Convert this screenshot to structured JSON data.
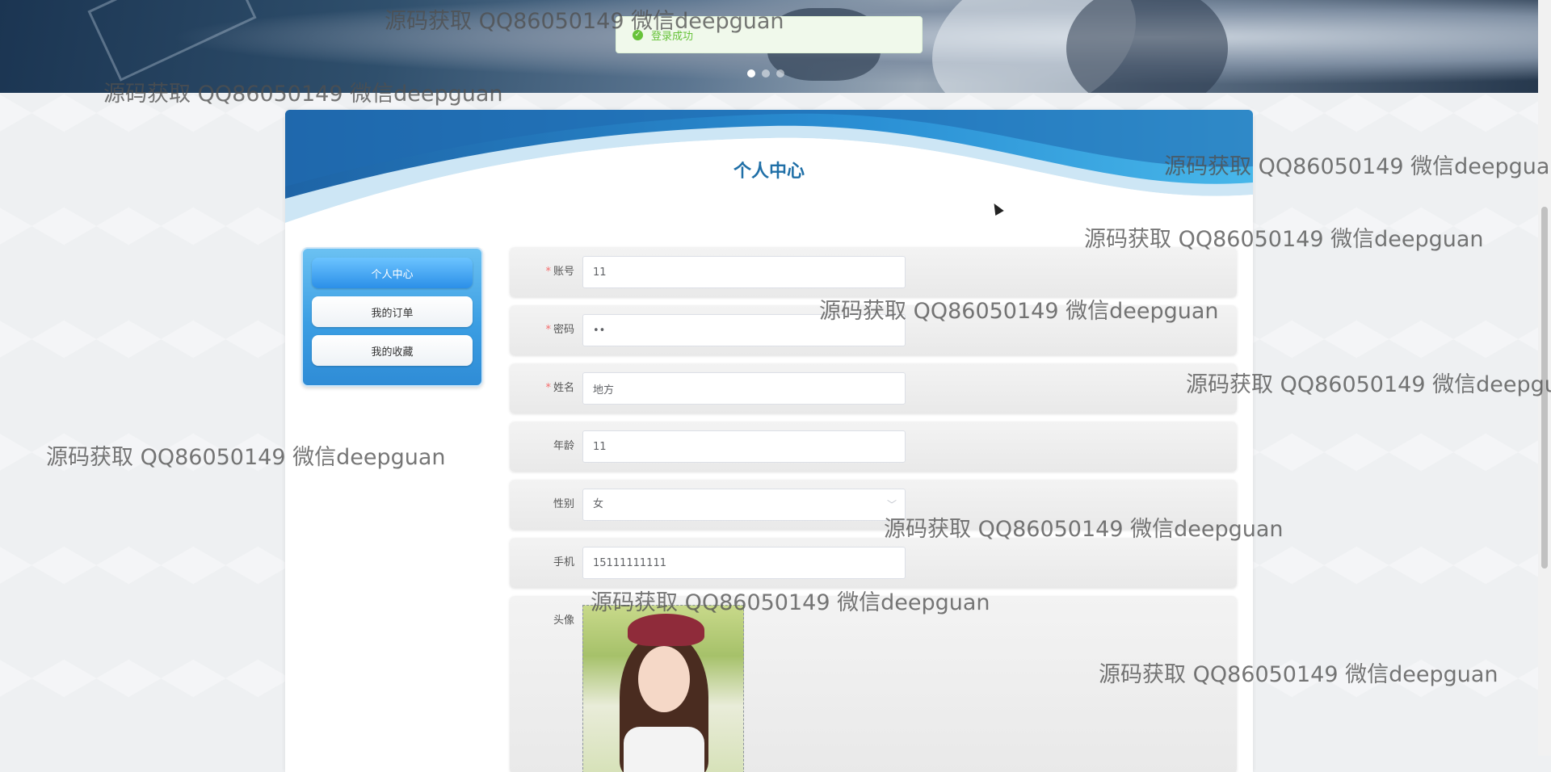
{
  "toast": {
    "message": "登录成功",
    "icon": "check-circle-icon"
  },
  "banner": {
    "carousel_dots": 3,
    "active_dot": 1
  },
  "panel": {
    "title": "个人中心"
  },
  "side_menu": {
    "items": [
      {
        "label": "个人中心",
        "active": true
      },
      {
        "label": "我的订单",
        "active": false
      },
      {
        "label": "我的收藏",
        "active": false
      }
    ]
  },
  "form": {
    "account": {
      "label": "账号",
      "value": "11",
      "required": true
    },
    "password": {
      "label": "密码",
      "value": "••",
      "required": true
    },
    "name": {
      "label": "姓名",
      "value": "地方",
      "required": true
    },
    "age": {
      "label": "年龄",
      "value": "11"
    },
    "gender": {
      "label": "性别",
      "value": "女"
    },
    "phone": {
      "label": "手机",
      "value": "15111111111"
    },
    "avatar": {
      "label": "头像"
    }
  },
  "watermark": {
    "text": "源码获取 QQ86050149 微信deepguan"
  },
  "colors": {
    "primary": "#2b8fe8",
    "title": "#1f6fa7",
    "required": "#f56c6c",
    "success": "#67c23a"
  }
}
